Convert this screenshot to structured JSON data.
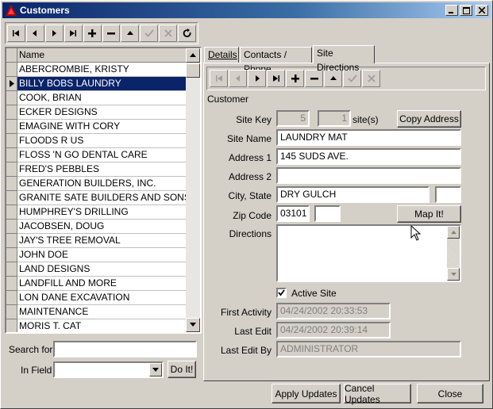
{
  "window": {
    "title": "Customers"
  },
  "grid": {
    "column_name": "Name",
    "rows": [
      "ABERCROMBIE, KRISTY",
      "BILLY BOBS LAUNDRY",
      "COOK, BRIAN",
      "ECKER DESIGNS",
      "EMAGINE WITH CORY",
      "FLOODS R US",
      "FLOSS 'N GO DENTAL CARE",
      "FRED'S PEBBLES",
      "GENERATION BUILDERS, INC.",
      "GRANITE SATE BUILDERS AND SONS",
      "HUMPHREY'S DRILLING",
      "JACOBSEN, DOUG",
      "JAY'S TREE REMOVAL",
      "JOHN DOE",
      "LAND DESIGNS",
      "LANDFILL AND MORE",
      "LON DANE EXCAVATION",
      "MAINTENANCE",
      "MORIS T. CAT"
    ],
    "selected_index": 1
  },
  "search": {
    "search_for_label": "Search for",
    "search_for_value": "",
    "in_field_label": "In Field",
    "in_field_value": "",
    "do_it_label": "Do It!"
  },
  "tabs": [
    {
      "label": "Details",
      "active": false
    },
    {
      "label": "Contacts / Phone",
      "active": false
    },
    {
      "label": "Site Directions",
      "active": true
    }
  ],
  "site": {
    "section_label": "Customer",
    "site_key_label": "Site Key",
    "site_key_value": "5",
    "site_count_value": "1",
    "site_count_suffix": "site(s)",
    "copy_address_label": "Copy Address",
    "site_name_label": "Site Name",
    "site_name_value": "LAUNDRY MAT",
    "address1_label": "Address 1",
    "address1_value": "145 SUDS AVE.",
    "address2_label": "Address 2",
    "address2_value": "",
    "city_state_label": "City, State",
    "city_value": "DRY GULCH",
    "state_value": "",
    "zip_label": "Zip Code",
    "zip_value": "03101",
    "zip_ext_value": "",
    "map_it_label": "Map It!",
    "directions_label": "Directions",
    "directions_value": "",
    "active_site_label": "Active Site",
    "active_site_checked": true,
    "first_activity_label": "First Activity",
    "first_activity_value": "04/24/2002 20:33:53",
    "last_edit_label": "Last Edit",
    "last_edit_value": "04/24/2002 20:39:14",
    "last_edit_by_label": "Last Edit By",
    "last_edit_by_value": "ADMINISTRATOR"
  },
  "footer": {
    "apply_label": "Apply Updates",
    "cancel_label": "Cancel Updates",
    "close_label": "Close"
  },
  "colors": {
    "titlebar": "#0a246a",
    "selection": "#0a246a",
    "face": "#d4d0c8"
  }
}
